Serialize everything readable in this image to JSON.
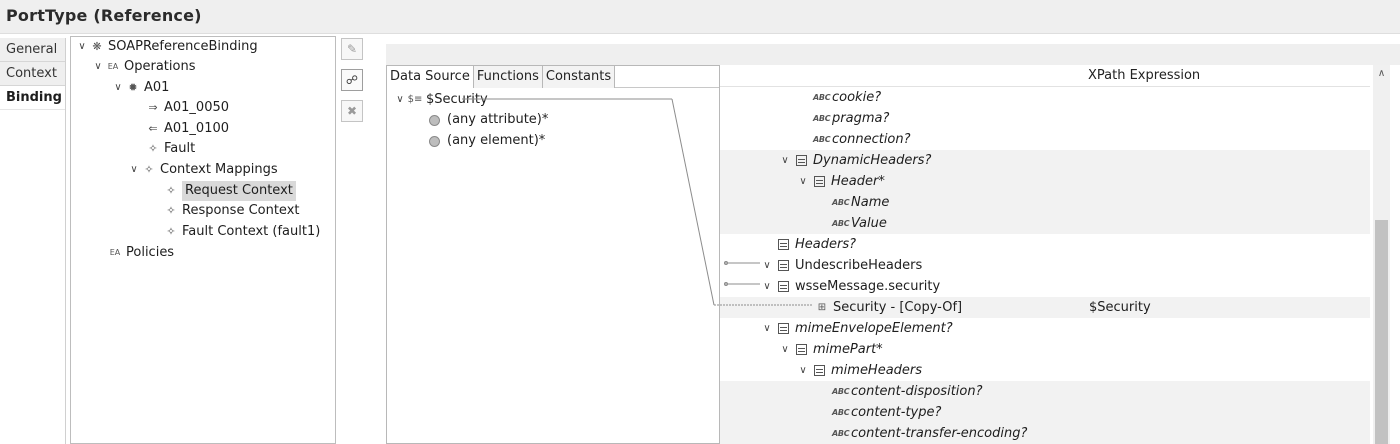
{
  "window": {
    "title": "PortType (Reference)"
  },
  "tabs": [
    {
      "label": "General"
    },
    {
      "label": "Context"
    },
    {
      "label": "Binding"
    }
  ],
  "tree": {
    "root": "SOAPReferenceBinding",
    "operations": "Operations",
    "op": "A01",
    "in_msg": "A01_0050",
    "out_msg": "A01_0100",
    "fault": "Fault",
    "context_mappings": "Context Mappings",
    "request_context": "Request Context",
    "response_context": "Response Context",
    "fault_context": "Fault Context (fault1)",
    "policies": "Policies"
  },
  "toolbar": {
    "icons": [
      "add-mapping-icon",
      "edit-mapping-icon",
      "delete-mapping-icon"
    ]
  },
  "data_source": {
    "tabs": [
      "Data Source",
      "Functions",
      "Constants"
    ],
    "root": "$Security",
    "items": [
      "(any attribute)*",
      "(any element)*"
    ]
  },
  "target": {
    "column_header": "XPath Expression",
    "rows": [
      {
        "label": "cookie?",
        "icon": "abc"
      },
      {
        "label": "pragma?",
        "icon": "abc"
      },
      {
        "label": "connection?",
        "icon": "abc"
      },
      {
        "label": "DynamicHeaders?",
        "icon": "element"
      },
      {
        "label": "Header*",
        "icon": "element"
      },
      {
        "label": "Name",
        "icon": "abc"
      },
      {
        "label": "Value",
        "icon": "abc"
      },
      {
        "label": "Headers?",
        "icon": "element"
      },
      {
        "label": "UndescribeHeaders",
        "icon": "element"
      },
      {
        "label": "wsseMessage.security",
        "icon": "element"
      },
      {
        "label": "Security - [Copy-Of]",
        "icon": "copy-of",
        "expr": "$Security"
      },
      {
        "label": "mimeEnvelopeElement?",
        "icon": "element"
      },
      {
        "label": "mimePart*",
        "icon": "element"
      },
      {
        "label": "mimeHeaders",
        "icon": "element"
      },
      {
        "label": "content-disposition?",
        "icon": "abc"
      },
      {
        "label": "content-type?",
        "icon": "abc"
      },
      {
        "label": "content-transfer-encoding?",
        "icon": "abc"
      }
    ]
  }
}
